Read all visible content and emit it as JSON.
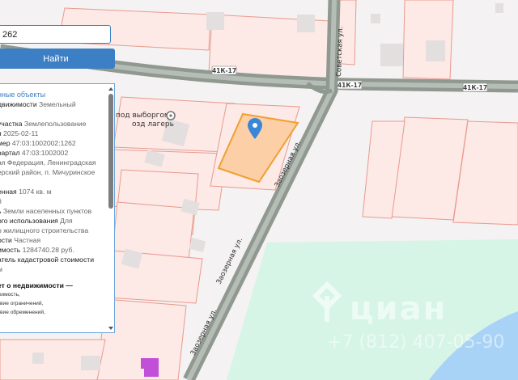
{
  "search": {
    "value": "262"
  },
  "find_button": {
    "label": "Найти"
  },
  "panel": {
    "header": "нные объекты",
    "lines": [
      {
        "k": "движимости",
        "v": " Земельный"
      },
      {
        "k": "",
        "v": ""
      },
      {
        "k": "участка",
        "v": " Землепользование"
      },
      {
        "k": "я",
        "v": " 2025-02-11"
      },
      {
        "k": "мер",
        "v": " 47:03:1002002:1262"
      },
      {
        "k": "вартал",
        "v": " 47:03:1002002"
      },
      {
        "k": "",
        "v": "ая Федерация, Ленинградская"
      },
      {
        "k": "",
        "v": "ерский район, п. Мичуринское"
      },
      {
        "k": "",
        "v": ""
      },
      {
        "k": "енная",
        "v": " 1074 кв. м"
      },
      {
        "k": "",
        "v": "й"
      },
      {
        "k": "ь",
        "v": " Земли населенных пунктов"
      },
      {
        "k": "ого использования",
        "v": " Для"
      },
      {
        "k": "",
        "v": "о жилищного строительства"
      },
      {
        "k": "ости",
        "v": " Частная"
      },
      {
        "k": "имость",
        "v": " 1284740.28 руб."
      },
      {
        "k": "атель кадастровой стоимости",
        "v": ""
      },
      {
        "k": "",
        "v": "м"
      }
    ],
    "section_title": "ет о недвижимости —",
    "tiny_lines": [
      "жимость,",
      "твие ограничений,",
      "твие обременений,"
    ]
  },
  "map": {
    "poi_label": "под выборгом\nозд лагерь",
    "road_badges": [
      "41К-17",
      "41К-17",
      "41К-17"
    ],
    "streets": [
      "Советская ул.",
      "Заозерная ул.",
      "Заозерная ул.",
      "Заозерная ул."
    ],
    "watermark": "циан",
    "watermark_phone": "+7 (812) 407-05-90"
  },
  "colors": {
    "parcel_fill": "#fde9e6",
    "parcel_stroke": "#e99a8e",
    "road": "#8f9990",
    "selected_fill": "#fccfa6",
    "selected_stroke": "#f0a030",
    "park": "#d6f5e6",
    "water": "#a9d2f7",
    "pin": "#3a86d8",
    "accent": "#3d7fc4"
  }
}
